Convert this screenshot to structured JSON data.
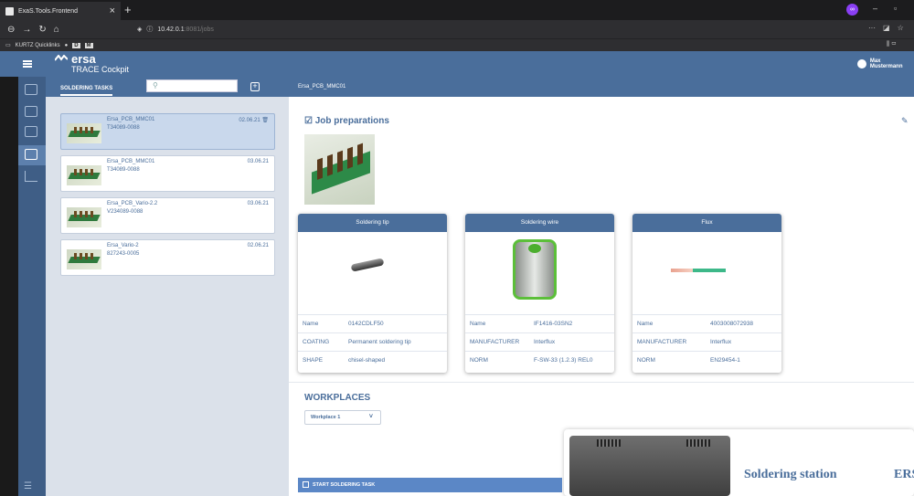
{
  "browser": {
    "tab_title": "ExaS.Tools.Frontend",
    "url_host": "10.42.0.1",
    "url_rest": ":8081/jobs",
    "bookmark_label": "KURTZ Quicklinks",
    "bookmark_d": "D"
  },
  "header": {
    "brand": "ersa",
    "product": "TRACE Cockpit",
    "user": "Max Mustermann"
  },
  "side": {
    "tab_label": "SOLDERING TASKS",
    "jobs": [
      {
        "name": "Ersa_PCB_MMC01",
        "code": "T34089-0088",
        "date": "02.06.21"
      },
      {
        "name": "Ersa_PCB_MMC01",
        "code": "T34089-0088",
        "date": "03.06.21"
      },
      {
        "name": "Ersa_PCB_Vario-2.2",
        "code": "V234089-0088",
        "date": "03.06.21"
      },
      {
        "name": "Ersa_Vario-2",
        "code": "827243-0005",
        "date": "02.06.21"
      }
    ]
  },
  "main": {
    "breadcrumb": "Ersa_PCB_MMC01",
    "job_title": "Job preparations",
    "components": [
      {
        "title": "Soldering tip",
        "rows": [
          [
            "Name",
            "0142CDLF50"
          ],
          [
            "COATING",
            "Permanent soldering tip"
          ],
          [
            "SHAPE",
            "chisel-shaped"
          ]
        ]
      },
      {
        "title": "Soldering wire",
        "rows": [
          [
            "Name",
            "IF1416-03SN2"
          ],
          [
            "MANUFACTURER",
            "Interflux"
          ],
          [
            "NORM",
            "F-SW-33 (1.2.3) REL0"
          ]
        ]
      },
      {
        "title": "Flux",
        "rows": [
          [
            "Name",
            "4003008072938"
          ],
          [
            "MANUFACTURER",
            "Interflux"
          ],
          [
            "NORM",
            "EN29454-1"
          ]
        ]
      }
    ],
    "workplaces_title": "WORKPLACES",
    "workplace_selected": "Workplace 1",
    "start_button": "START SOLDERING TASK",
    "station_title": "Soldering station",
    "station_brand": "ERS"
  }
}
